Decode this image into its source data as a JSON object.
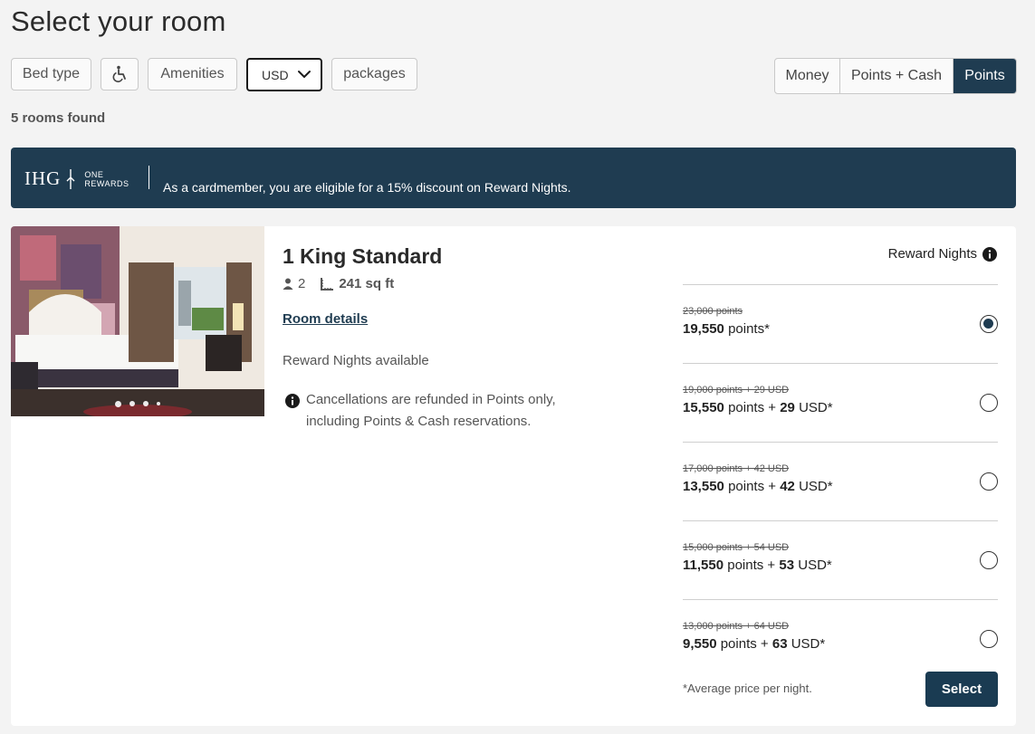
{
  "page_title": "Select your room",
  "filters": {
    "bed_type": "Bed type",
    "accessible_icon": "wheelchair-icon",
    "amenities": "Amenities",
    "currency": "USD",
    "packages": "packages"
  },
  "pay_modes": [
    "Money",
    "Points + Cash",
    "Points"
  ],
  "active_mode": "Points",
  "rooms_found": "5 rooms found",
  "banner": {
    "logo_text": "IHG",
    "logo_sub_1": "ONE",
    "logo_sub_2": "REWARDS",
    "message": "As a cardmember, you are eligible for a 15% discount on Reward Nights."
  },
  "room": {
    "title": "1 King Standard",
    "guests": "2",
    "size": "241 sq ft",
    "details_link": "Room details",
    "availability": "Reward Nights available",
    "cancellation": "Cancellations are refunded in Points only, including Points & Cash reservations.",
    "reward_header": "Reward Nights",
    "gallery_count": 4,
    "rates": [
      {
        "original": "23,000 points",
        "points": "19,550",
        "points_label": "points",
        "cash": "",
        "suffix": "*",
        "selected": true
      },
      {
        "original": "19,000 points + 29 USD",
        "points": "15,550",
        "points_label": "points +",
        "cash": "29",
        "suffix": "USD*",
        "selected": false
      },
      {
        "original": "17,000 points + 42 USD",
        "points": "13,550",
        "points_label": "points +",
        "cash": "42",
        "suffix": "USD*",
        "selected": false
      },
      {
        "original": "15,000 points + 54 USD",
        "points": "11,550",
        "points_label": "points +",
        "cash": "53",
        "suffix": "USD*",
        "selected": false
      },
      {
        "original": "13,000 points + 64 USD",
        "points": "9,550",
        "points_label": "points +",
        "cash": "63",
        "suffix": "USD*",
        "selected": false
      }
    ],
    "avg_note": "*Average price per night.",
    "select_label": "Select"
  },
  "colors": {
    "brand": "#1f3c51",
    "background": "#f3f3f3"
  }
}
